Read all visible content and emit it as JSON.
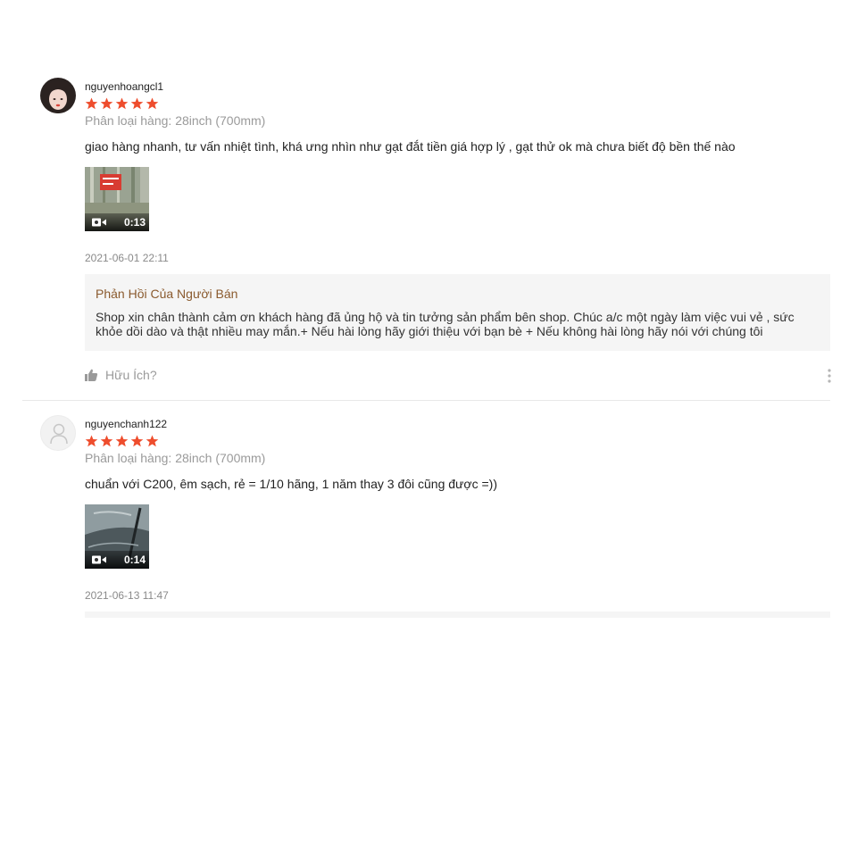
{
  "reviews": [
    {
      "username": "nguyenhoangcl1",
      "rating": 5,
      "variant": "Phân loại hàng: 28inch (700mm)",
      "comment": "giao hàng nhanh, tư vấn nhiệt tình, khá ưng nhìn như gạt đắt tiền giá hợp lý , gạt thử ok mà chưa biết độ bền thế nào",
      "video_duration": "0:13",
      "timestamp": "2021-06-01 22:11",
      "seller_reply_title": "Phản Hồi Của Người Bán",
      "seller_reply_text": "Shop xin chân thành cảm ơn khách hàng đã ủng hộ và tin tưởng sản phẩm bên shop. Chúc a/c một ngày làm việc vui vẻ , sức khỏe dồi dào và thật nhiều may mắn.+ Nếu hài lòng hãy giới thiệu với bạn bè + Nếu không hài lòng hãy nói với chúng tôi",
      "helpful_label": "Hữu Ích?"
    },
    {
      "username": "nguyenchanh122",
      "rating": 5,
      "variant": "Phân loại hàng: 28inch (700mm)",
      "comment": "chuẩn với C200, êm sạch, rẻ = 1/10 hãng, 1 năm thay 3 đôi cũng được =))",
      "video_duration": "0:14",
      "timestamp": "2021-06-13 11:47"
    }
  ],
  "colors": {
    "star": "#ee4d2d",
    "seller_title": "#8a5a2e",
    "muted": "#9a9a9a",
    "reply_bg": "#f5f5f5"
  },
  "icons": [
    "avatar-photo",
    "default-avatar-icon",
    "star-icon",
    "video-camera-icon",
    "thumbs-up-icon",
    "more-dots-icon"
  ]
}
